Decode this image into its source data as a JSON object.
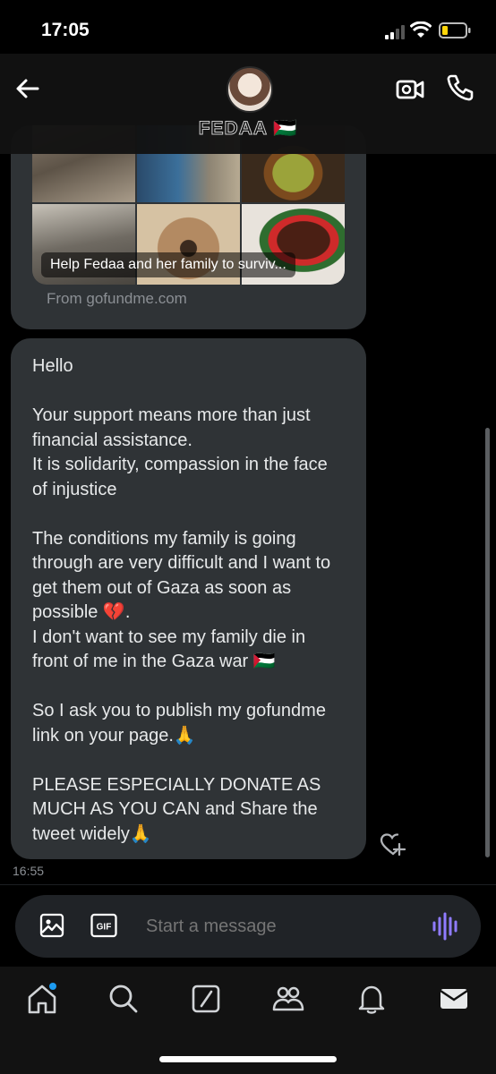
{
  "status_bar": {
    "time": "17:05"
  },
  "header": {
    "contact_name": "FEDAA 🇵🇸"
  },
  "link_card": {
    "caption": "Help Fedaa and her family to surviv...",
    "source": "From gofundme.com"
  },
  "message": {
    "text": "Hello\n\nYour support means more than just financial assistance.\nIt is solidarity, compassion in the face of injustice\n\nThe conditions my family is going through are very difficult and I want to get them out of Gaza as soon as possible 💔.\nI don't want to see my family die in front of me in the Gaza war 🇵🇸\n\nSo I ask you to publish my gofundme link on your page.🙏\n\nPLEASE ESPECIALLY DONATE AS MUCH AS YOU CAN and Share the tweet widely🙏",
    "timestamp": "16:55"
  },
  "composer": {
    "placeholder": "Start a message",
    "gif_label": "GIF"
  },
  "icons": {
    "back": "arrow-left-icon",
    "video": "video-call-icon",
    "call": "phone-icon",
    "like": "heart-plus-icon",
    "image": "image-icon",
    "gif": "gif-icon",
    "voice": "voice-wave-icon",
    "nav": [
      "home-icon",
      "search-icon",
      "grok-icon",
      "communities-icon",
      "notifications-icon",
      "messages-icon"
    ]
  },
  "colors": {
    "accent": "#1d9bf0",
    "voice": "#8f7bff",
    "bubble": "#2f3336"
  }
}
